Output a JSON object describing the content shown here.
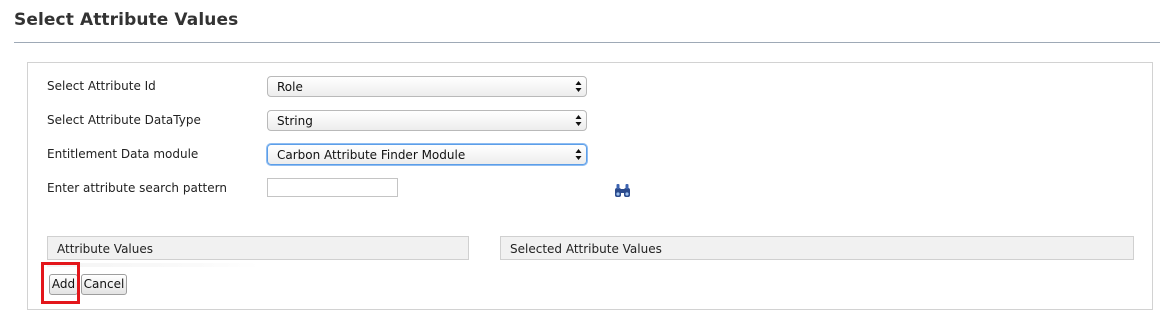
{
  "header": {
    "title": "Select Attribute Values"
  },
  "form": {
    "attribute_id": {
      "label": "Select Attribute Id",
      "value": "Role"
    },
    "attribute_datatype": {
      "label": "Select Attribute DataType",
      "value": "String"
    },
    "entitlement_module": {
      "label": "Entitlement Data module",
      "value": "Carbon Attribute Finder Module"
    },
    "search_pattern": {
      "label": "Enter attribute search pattern",
      "value": ""
    },
    "search_icon": "binoculars-icon"
  },
  "lists": {
    "available_header": "Attribute Values",
    "selected_header": "Selected Attribute Values"
  },
  "buttons": {
    "add_label": "Add",
    "cancel_label": "Cancel"
  },
  "colors": {
    "highlight": "#e3161b",
    "focus": "#5c9ee8",
    "icon": "#2b4a8c"
  }
}
